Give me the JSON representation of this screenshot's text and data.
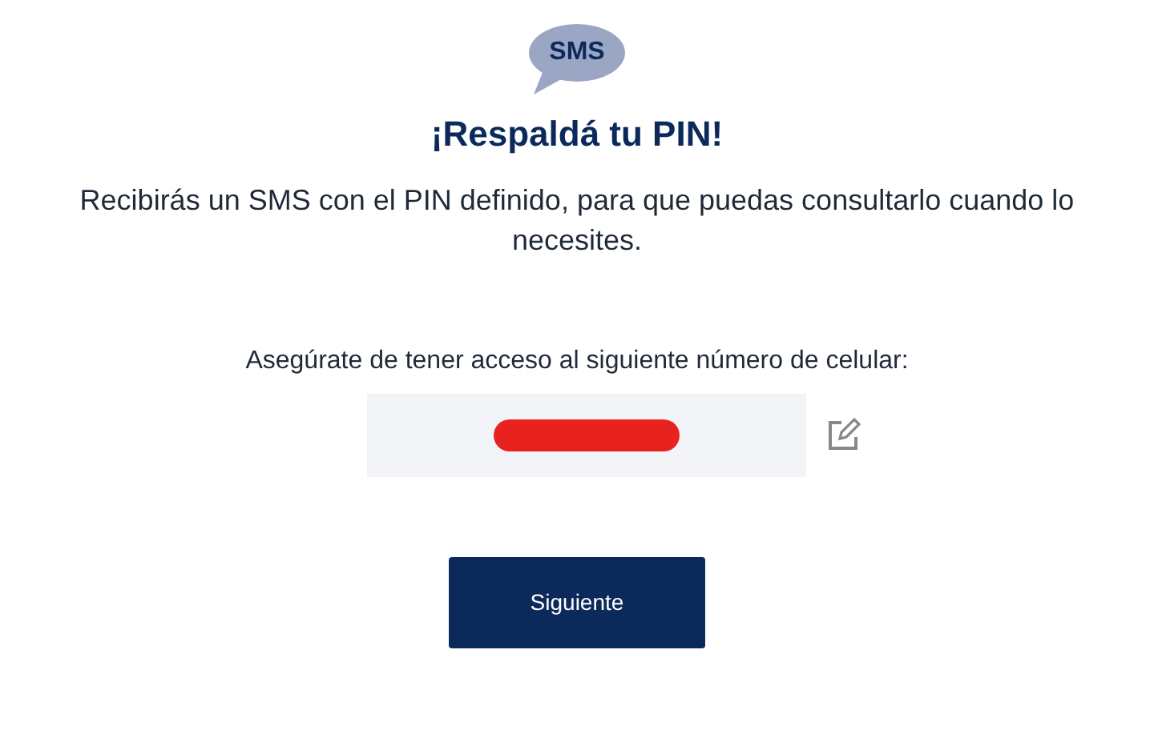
{
  "icon": {
    "text": "SMS"
  },
  "title": "¡Respaldá tu PIN!",
  "message": "Recibirás un SMS con el PIN definido, para que puedas consultarlo cuando lo necesites.",
  "phone": {
    "label": "Asegúrate de tener acceso al siguiente número de celular:",
    "redacted": true
  },
  "button": "Siguiente"
}
